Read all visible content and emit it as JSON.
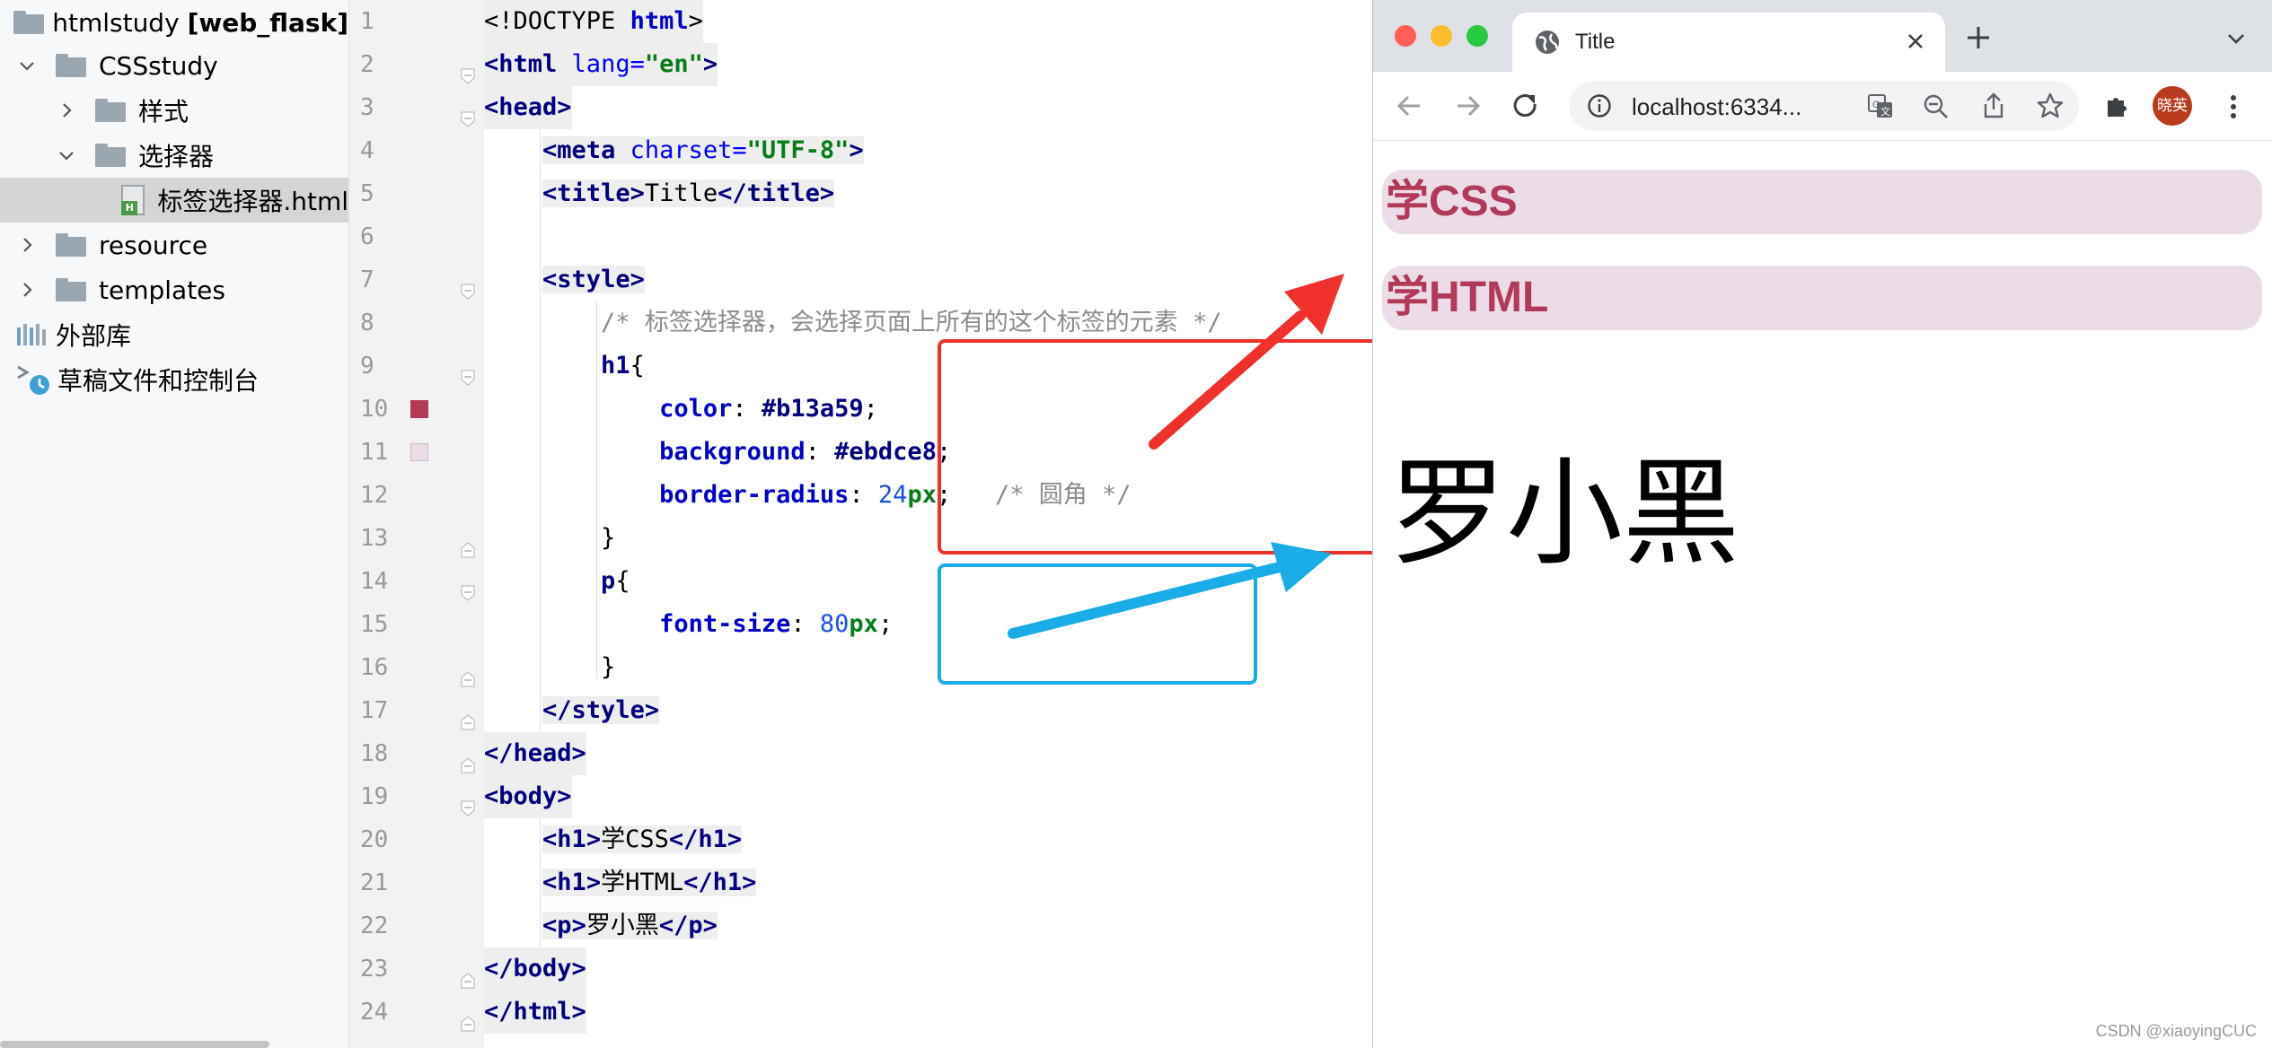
{
  "project_tree": {
    "root_name": "htmlstudy",
    "root_module": "[web_flask]",
    "items": [
      {
        "label": "CSSstudy"
      },
      {
        "label": "样式"
      },
      {
        "label": "选择器"
      },
      {
        "label": "标签选择器.html"
      },
      {
        "label": "resource"
      },
      {
        "label": "templates"
      },
      {
        "label": "外部库"
      },
      {
        "label": "草稿文件和控制台"
      }
    ]
  },
  "editor": {
    "line_numbers": [
      "1",
      "2",
      "3",
      "4",
      "5",
      "6",
      "7",
      "8",
      "9",
      "10",
      "11",
      "12",
      "13",
      "14",
      "15",
      "16",
      "17",
      "18",
      "19",
      "20",
      "21",
      "22",
      "23",
      "24"
    ],
    "text": {
      "l1_doctype": "<!DOCTYPE ",
      "l1_html": "html",
      "l1_close": ">",
      "l2_open": "<",
      "l2_tag": "html",
      "l2_attr": " lang",
      "l2_eq": "=",
      "l2_val": "\"en\"",
      "l2_close": ">",
      "l3": "head",
      "l4_tag": "meta",
      "l4_attr": " charset",
      "l4_val": "\"UTF-8\"",
      "l5_tag": "title",
      "l5_text": "Title",
      "l7_tag": "style",
      "l8_comment": "/* 标签选择器，会选择页面上所有的这个标签的元素 */",
      "l9_sel": "h1",
      "l9_brace": "{",
      "l10_prop": "color",
      "l10_val": "#b13a59",
      "l11_prop": "background",
      "l11_val": "#ebdce8",
      "l12_prop": "border-radius",
      "l12_num": "24",
      "l12_unit": "px",
      "l12_comment": "/* 圆角 */",
      "l13_brace": "}",
      "l14_sel": "p",
      "l14_brace": "{",
      "l15_prop": "font-size",
      "l15_num": "80",
      "l15_unit": "px",
      "l16_brace": "}",
      "l17_tag": "style",
      "l18_tag": "head",
      "l19_tag": "body",
      "l20_tag": "h1",
      "l20_text": "学CSS",
      "l21_tag": "h1",
      "l21_text": "学HTML",
      "l22_tag": "p",
      "l22_text": "罗小黑",
      "l23_tag": "body",
      "l24_tag": "html"
    },
    "swatch_colors": {
      "color": "#b13a59",
      "background": "#ebdce8"
    }
  },
  "browser": {
    "tab_title": "Title",
    "url": "localhost:6334...",
    "avatar_text": "晓英",
    "page": {
      "h1_1": "学CSS",
      "h1_2": "学HTML",
      "p": "罗小黑"
    }
  },
  "watermark": "CSDN @xiaoyingCUC",
  "accent_colors": {
    "red_box": "#f0302a",
    "blue_box": "#1aace6"
  }
}
